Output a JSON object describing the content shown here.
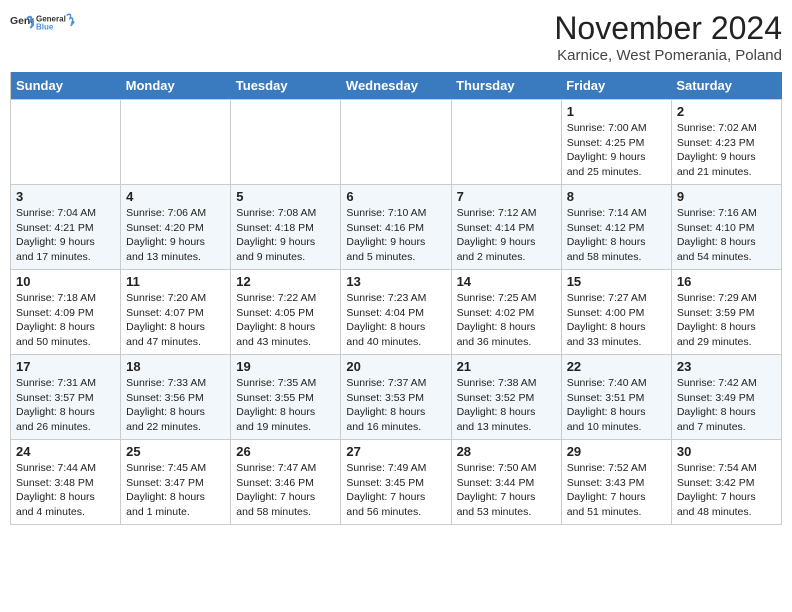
{
  "logo": {
    "general": "General",
    "blue": "Blue"
  },
  "title": "November 2024",
  "location": "Karnice, West Pomerania, Poland",
  "days_of_week": [
    "Sunday",
    "Monday",
    "Tuesday",
    "Wednesday",
    "Thursday",
    "Friday",
    "Saturday"
  ],
  "weeks": [
    [
      {
        "day": "",
        "info": ""
      },
      {
        "day": "",
        "info": ""
      },
      {
        "day": "",
        "info": ""
      },
      {
        "day": "",
        "info": ""
      },
      {
        "day": "",
        "info": ""
      },
      {
        "day": "1",
        "info": "Sunrise: 7:00 AM\nSunset: 4:25 PM\nDaylight: 9 hours and 25 minutes."
      },
      {
        "day": "2",
        "info": "Sunrise: 7:02 AM\nSunset: 4:23 PM\nDaylight: 9 hours and 21 minutes."
      }
    ],
    [
      {
        "day": "3",
        "info": "Sunrise: 7:04 AM\nSunset: 4:21 PM\nDaylight: 9 hours and 17 minutes."
      },
      {
        "day": "4",
        "info": "Sunrise: 7:06 AM\nSunset: 4:20 PM\nDaylight: 9 hours and 13 minutes."
      },
      {
        "day": "5",
        "info": "Sunrise: 7:08 AM\nSunset: 4:18 PM\nDaylight: 9 hours and 9 minutes."
      },
      {
        "day": "6",
        "info": "Sunrise: 7:10 AM\nSunset: 4:16 PM\nDaylight: 9 hours and 5 minutes."
      },
      {
        "day": "7",
        "info": "Sunrise: 7:12 AM\nSunset: 4:14 PM\nDaylight: 9 hours and 2 minutes."
      },
      {
        "day": "8",
        "info": "Sunrise: 7:14 AM\nSunset: 4:12 PM\nDaylight: 8 hours and 58 minutes."
      },
      {
        "day": "9",
        "info": "Sunrise: 7:16 AM\nSunset: 4:10 PM\nDaylight: 8 hours and 54 minutes."
      }
    ],
    [
      {
        "day": "10",
        "info": "Sunrise: 7:18 AM\nSunset: 4:09 PM\nDaylight: 8 hours and 50 minutes."
      },
      {
        "day": "11",
        "info": "Sunrise: 7:20 AM\nSunset: 4:07 PM\nDaylight: 8 hours and 47 minutes."
      },
      {
        "day": "12",
        "info": "Sunrise: 7:22 AM\nSunset: 4:05 PM\nDaylight: 8 hours and 43 minutes."
      },
      {
        "day": "13",
        "info": "Sunrise: 7:23 AM\nSunset: 4:04 PM\nDaylight: 8 hours and 40 minutes."
      },
      {
        "day": "14",
        "info": "Sunrise: 7:25 AM\nSunset: 4:02 PM\nDaylight: 8 hours and 36 minutes."
      },
      {
        "day": "15",
        "info": "Sunrise: 7:27 AM\nSunset: 4:00 PM\nDaylight: 8 hours and 33 minutes."
      },
      {
        "day": "16",
        "info": "Sunrise: 7:29 AM\nSunset: 3:59 PM\nDaylight: 8 hours and 29 minutes."
      }
    ],
    [
      {
        "day": "17",
        "info": "Sunrise: 7:31 AM\nSunset: 3:57 PM\nDaylight: 8 hours and 26 minutes."
      },
      {
        "day": "18",
        "info": "Sunrise: 7:33 AM\nSunset: 3:56 PM\nDaylight: 8 hours and 22 minutes."
      },
      {
        "day": "19",
        "info": "Sunrise: 7:35 AM\nSunset: 3:55 PM\nDaylight: 8 hours and 19 minutes."
      },
      {
        "day": "20",
        "info": "Sunrise: 7:37 AM\nSunset: 3:53 PM\nDaylight: 8 hours and 16 minutes."
      },
      {
        "day": "21",
        "info": "Sunrise: 7:38 AM\nSunset: 3:52 PM\nDaylight: 8 hours and 13 minutes."
      },
      {
        "day": "22",
        "info": "Sunrise: 7:40 AM\nSunset: 3:51 PM\nDaylight: 8 hours and 10 minutes."
      },
      {
        "day": "23",
        "info": "Sunrise: 7:42 AM\nSunset: 3:49 PM\nDaylight: 8 hours and 7 minutes."
      }
    ],
    [
      {
        "day": "24",
        "info": "Sunrise: 7:44 AM\nSunset: 3:48 PM\nDaylight: 8 hours and 4 minutes."
      },
      {
        "day": "25",
        "info": "Sunrise: 7:45 AM\nSunset: 3:47 PM\nDaylight: 8 hours and 1 minute."
      },
      {
        "day": "26",
        "info": "Sunrise: 7:47 AM\nSunset: 3:46 PM\nDaylight: 7 hours and 58 minutes."
      },
      {
        "day": "27",
        "info": "Sunrise: 7:49 AM\nSunset: 3:45 PM\nDaylight: 7 hours and 56 minutes."
      },
      {
        "day": "28",
        "info": "Sunrise: 7:50 AM\nSunset: 3:44 PM\nDaylight: 7 hours and 53 minutes."
      },
      {
        "day": "29",
        "info": "Sunrise: 7:52 AM\nSunset: 3:43 PM\nDaylight: 7 hours and 51 minutes."
      },
      {
        "day": "30",
        "info": "Sunrise: 7:54 AM\nSunset: 3:42 PM\nDaylight: 7 hours and 48 minutes."
      }
    ]
  ]
}
